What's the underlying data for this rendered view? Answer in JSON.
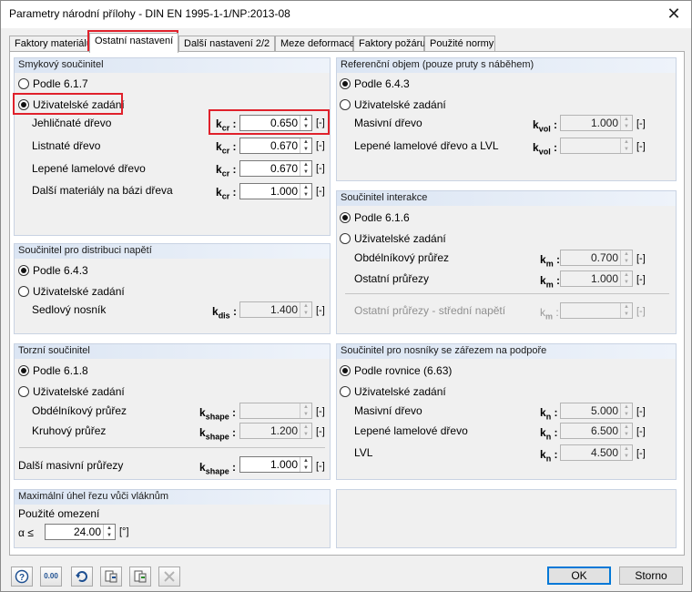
{
  "window": {
    "title": "Parametry národní přílohy - DIN EN 1995-1-1/NP:2013-08"
  },
  "tabs": [
    "Faktory materiálu",
    "Ostatní nastavení",
    "Další nastavení 2/2",
    "Meze deformace",
    "Faktory požáru",
    "Použité normy"
  ],
  "shear": {
    "title": "Smykový součinitel",
    "opt1": "Podle 6.1.7",
    "opt2": "Uživatelské zadání",
    "rows": [
      {
        "label": "Jehličnaté dřevo",
        "sym": "k",
        "sub": "cr",
        "value": "0.650",
        "unit": "[-]"
      },
      {
        "label": "Listnaté dřevo",
        "sym": "k",
        "sub": "cr",
        "value": "0.670",
        "unit": "[-]"
      },
      {
        "label": "Lepené lamelové dřevo",
        "sym": "k",
        "sub": "cr",
        "value": "0.670",
        "unit": "[-]"
      },
      {
        "label": "Další materiály na bázi dřeva",
        "sym": "k",
        "sub": "cr",
        "value": "1.000",
        "unit": "[-]"
      }
    ]
  },
  "distribution": {
    "title": "Součinitel pro distribuci napětí",
    "opt1": "Podle 6.4.3",
    "opt2": "Uživatelské zadání",
    "row": {
      "label": "Sedlový nosník",
      "sym": "k",
      "sub": "dis",
      "value": "1.400",
      "unit": "[-]"
    }
  },
  "torsion": {
    "title": "Torzní součinitel",
    "opt1": "Podle 6.1.8",
    "opt2": "Uživatelské zadání",
    "rows": [
      {
        "label": "Obdélníkový průřez",
        "sym": "k",
        "sub": "shape",
        "value": "",
        "unit": "[-]"
      },
      {
        "label": "Kruhový průřez",
        "sym": "k",
        "sub": "shape",
        "value": "1.200",
        "unit": "[-]"
      },
      {
        "label": "Další masivní průřezy",
        "sym": "k",
        "sub": "shape",
        "value": "1.000",
        "unit": "[-]"
      }
    ]
  },
  "grain": {
    "title": "Maximální úhel řezu vůči vláknům",
    "caption": "Použité omezení",
    "sym": "α ≤",
    "value": "24.00",
    "unit": "[°]"
  },
  "reference": {
    "title": "Referenční objem (pouze pruty s náběhem)",
    "opt1": "Podle 6.4.3",
    "opt2": "Uživatelské zadání",
    "rows": [
      {
        "label": "Masivní dřevo",
        "sym": "k",
        "sub": "vol",
        "value": "1.000",
        "unit": "[-]"
      },
      {
        "label": "Lepené lamelové dřevo a LVL",
        "sym": "k",
        "sub": "vol",
        "value": "",
        "unit": "[-]"
      }
    ]
  },
  "interaction": {
    "title": "Součinitel interakce",
    "opt1": "Podle 6.1.6",
    "opt2": "Uživatelské zadání",
    "rows": [
      {
        "label": "Obdélníkový průřez",
        "sym": "k",
        "sub": "m",
        "value": "0.700",
        "unit": "[-]"
      },
      {
        "label": "Ostatní průřezy",
        "sym": "k",
        "sub": "m",
        "value": "1.000",
        "unit": "[-]"
      },
      {
        "label": "Ostatní průřezy - střední napětí",
        "sym": "k",
        "sub": "m",
        "value": "",
        "unit": "[-]"
      }
    ]
  },
  "notch": {
    "title": "Součinitel pro nosníky se zářezem na podpoře",
    "opt1": "Podle rovnice (6.63)",
    "opt2": "Uživatelské zadání",
    "rows": [
      {
        "label": "Masivní dřevo",
        "sym": "k",
        "sub": "n",
        "value": "5.000",
        "unit": "[-]"
      },
      {
        "label": "Lepené lamelové dřevo",
        "sym": "k",
        "sub": "n",
        "value": "6.500",
        "unit": "[-]"
      },
      {
        "label": "LVL",
        "sym": "k",
        "sub": "n",
        "value": "4.500",
        "unit": "[-]"
      }
    ]
  },
  "toolbar": {
    "icons": [
      "help-icon",
      "decimal-places-icon",
      "reset-icon",
      "export-icon",
      "import-icon",
      "delete-icon"
    ],
    "decimals_glyph": "0.00"
  },
  "buttons": {
    "ok": "OK",
    "cancel": "Storno"
  },
  "colors": {
    "highlight": "#e0212b",
    "group_header": "#dbe5f3",
    "default_button_border": "#0078d7"
  }
}
